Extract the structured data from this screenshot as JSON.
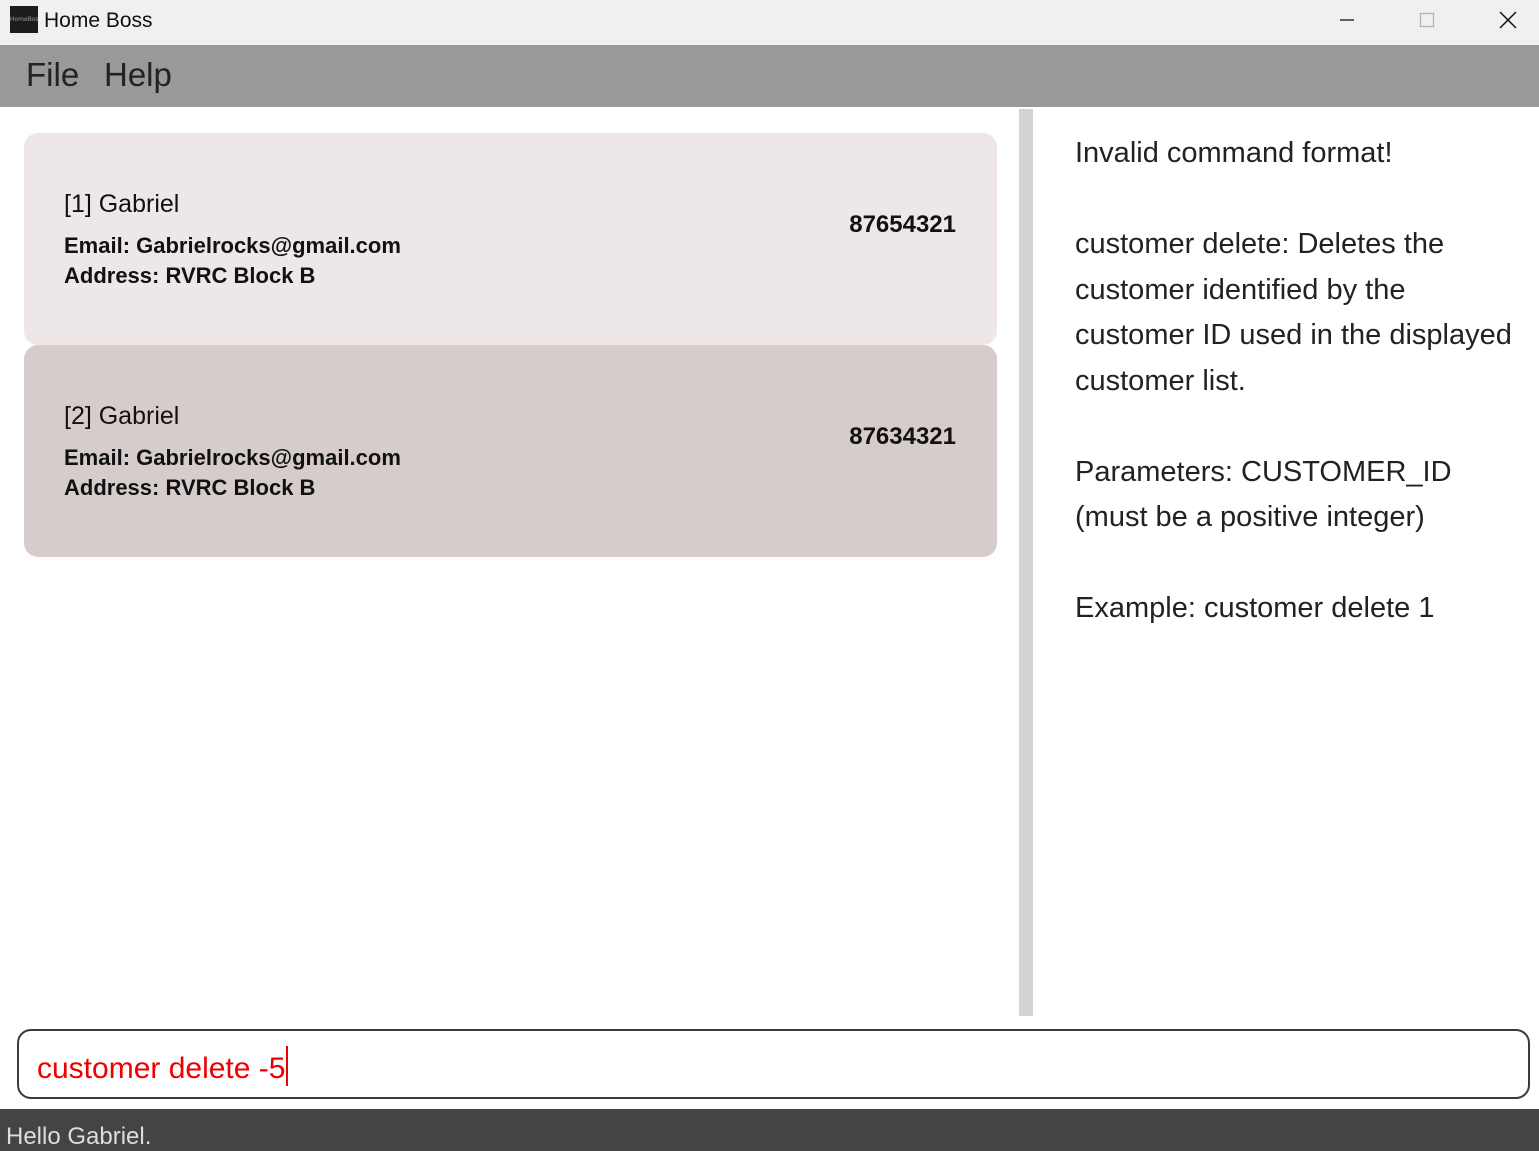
{
  "window": {
    "title": "Home Boss",
    "icon_text": "HomeBoss"
  },
  "menu": {
    "items": [
      "File",
      "Help"
    ]
  },
  "customers": [
    {
      "name": "[1] Gabriel",
      "email": "Email: Gabrielrocks@gmail.com",
      "address": "Address: RVRC Block B",
      "phone": "87654321"
    },
    {
      "name": "[2] Gabriel",
      "email": "Email: Gabrielrocks@gmail.com",
      "address": "Address: RVRC Block B",
      "phone": "87634321"
    }
  ],
  "result": {
    "text": "Invalid command format!\n\ncustomer delete: Deletes the customer identified by the customer ID used in the displayed customer list.\n\nParameters: CUSTOMER_ID (must be a positive integer)\n\nExample: customer delete 1"
  },
  "command": {
    "value": "customer delete -5",
    "error_color": "#ee0000"
  },
  "status": {
    "text": "Hello Gabriel."
  },
  "colors": {
    "menubar": "#999999",
    "card_odd": "#ede7e7",
    "card_even": "#d5cccb",
    "statusbar": "#444444"
  },
  "icons": [
    "app-logo-icon",
    "minimize-icon",
    "maximize-icon",
    "close-icon"
  ]
}
